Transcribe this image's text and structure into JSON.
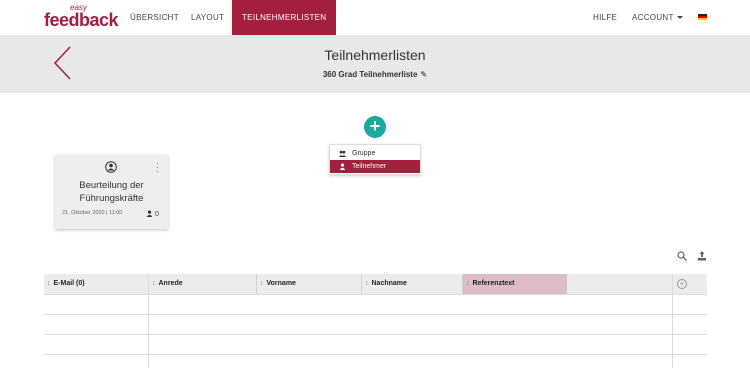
{
  "brand": {
    "small": "easy",
    "main": "feedback",
    "color": "#a31f3e"
  },
  "nav": {
    "items": [
      {
        "label": "ÜBERSICHT"
      },
      {
        "label": "LAYOUT"
      },
      {
        "label": "TEILNEHMERLISTEN",
        "active": true
      }
    ],
    "right": {
      "help": "HILFE",
      "account": "ACCOUNT"
    },
    "language_flag": "german-flag-icon"
  },
  "header": {
    "title": "Teilnehmerlisten",
    "subtitle": "360 Grad Teilnehmerliste"
  },
  "add_button": {
    "icon": "plus-icon",
    "color": "#1aa99d"
  },
  "add_menu": {
    "items": [
      {
        "label": "Gruppe",
        "icon": "group-icon"
      },
      {
        "label": "Teilnehmer",
        "icon": "person-icon",
        "selected": true
      }
    ]
  },
  "card": {
    "title_line1": "Beurteilung der",
    "title_line2": "Führungskräfte",
    "date": "21. Oktober 2020 | 11:00",
    "count": "0"
  },
  "table": {
    "columns": [
      "E-Mail (0)",
      "Anrede",
      "Vorname",
      "Nachname",
      "Referenztext"
    ],
    "highlight_color": "#dbbdc6"
  }
}
